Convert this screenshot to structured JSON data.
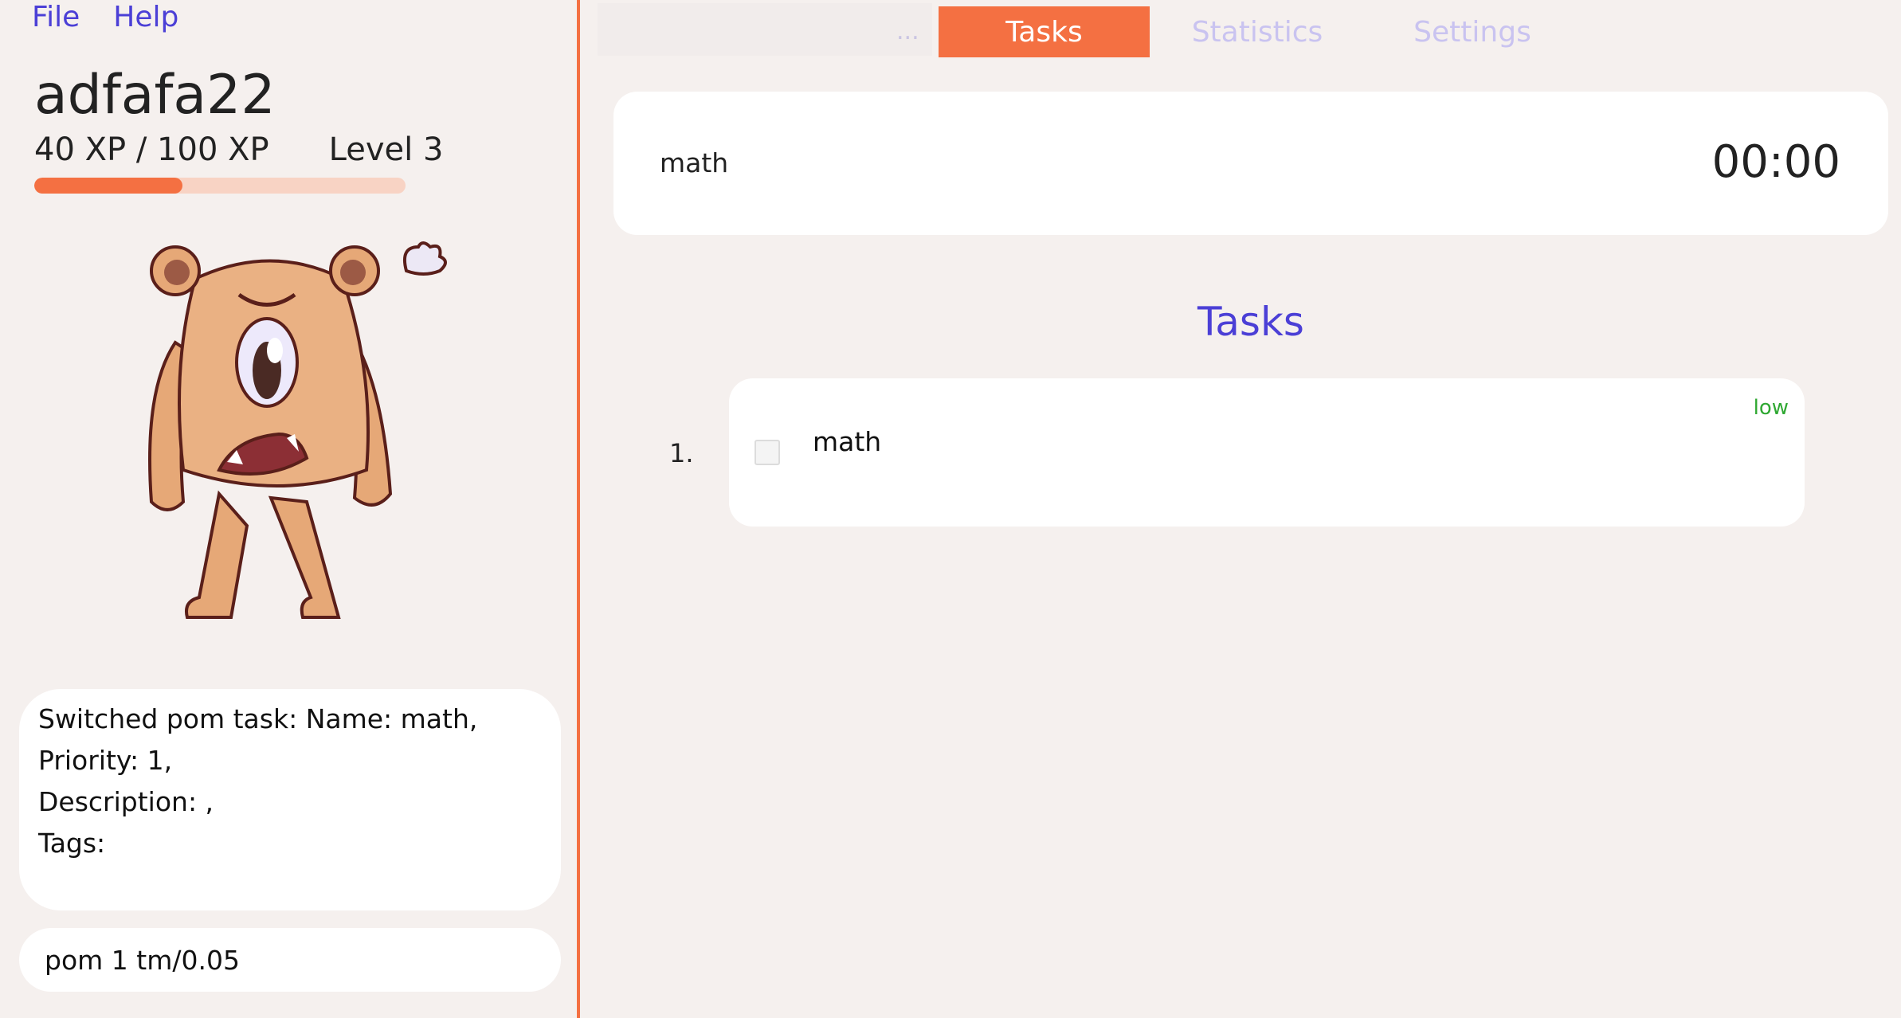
{
  "menu": {
    "file": "File",
    "help": "Help"
  },
  "profile": {
    "username": "adfafa22",
    "xp_text": "40 XP / 100 XP",
    "level_text": "Level 3",
    "xp_fraction": 0.4
  },
  "result_box": {
    "lines": [
      "Switched pom task: Name: math,",
      "Priority: 1,",
      "Description: ,",
      "Tags:"
    ]
  },
  "command_box": {
    "value": "pom 1 tm/0.05"
  },
  "tabs": {
    "more": "...",
    "tasks": "Tasks",
    "statistics": "Statistics",
    "settings": "Settings"
  },
  "timer": {
    "task": "math",
    "time": "00:00"
  },
  "task_list": {
    "heading": "Tasks",
    "items": [
      {
        "index": "1.",
        "name": "math",
        "priority": "low",
        "done": false
      }
    ]
  },
  "colors": {
    "accent": "#f47042",
    "heading": "#4b3fd6",
    "priority_low": "#2fa832",
    "background": "#f5f0ee"
  },
  "icons": {
    "mascot": "cyclops-bear-mascot-icon",
    "checkbox": "checkbox-icon"
  }
}
